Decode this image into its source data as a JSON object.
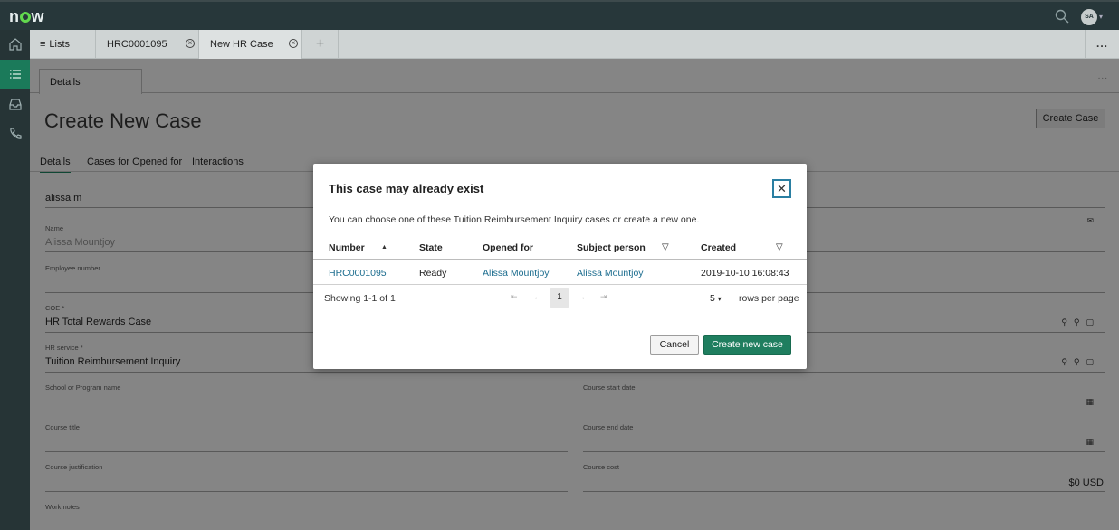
{
  "app": {
    "logo": "now",
    "avatar_initials": "SA"
  },
  "rail": [
    "home-icon",
    "list-icon",
    "inbox-icon",
    "phone-icon"
  ],
  "tabs": {
    "lists": "Lists",
    "case_tab": "HRC0001095",
    "new_tab": "New HR Case",
    "add": "+",
    "more": "..."
  },
  "page": {
    "subtab": "Details",
    "more": "...",
    "title": "Create New Case",
    "create_button": "Create Case",
    "form_tabs": [
      "Details",
      "Cases for Opened for",
      "Interactions"
    ],
    "search_value": "alissa m",
    "fields": {
      "name": {
        "label": "Name",
        "value": "Alissa Mountjoy"
      },
      "employee_number": {
        "label": "Employee number",
        "value": ""
      },
      "coe": {
        "label": "COE",
        "value": "HR Total Rewards Case"
      },
      "hr_service": {
        "label": "HR service",
        "value": "Tuition Reimbursement Inquiry"
      },
      "school": {
        "label": "School or Program name",
        "value": ""
      },
      "course_start": {
        "label": "Course start date",
        "value": ""
      },
      "course_title": {
        "label": "Course title",
        "value": ""
      },
      "course_end": {
        "label": "Course end date",
        "value": ""
      },
      "course_justification": {
        "label": "Course justification",
        "value": ""
      },
      "course_cost": {
        "label": "Course cost",
        "value": "$0 USD"
      },
      "work_notes": {
        "label": "Work notes",
        "value": ""
      }
    },
    "required_mark": "*"
  },
  "modal": {
    "title": "This case may already exist",
    "description": "You can choose one of these Tuition Reimbursement Inquiry cases or create a new one.",
    "columns": {
      "number": "Number",
      "state": "State",
      "opened_for": "Opened for",
      "subject_person": "Subject person",
      "created": "Created"
    },
    "rows": [
      {
        "number": "HRC0001095",
        "state": "Ready",
        "opened_for": "Alissa Mountjoy",
        "subject_person": "Alissa Mountjoy",
        "created": "2019-10-10 16:08:43"
      }
    ],
    "pager": {
      "showing": "Showing 1-1 of 1",
      "page": "1",
      "rows_per_page_value": "5",
      "rows_per_page_label": "rows per page"
    },
    "cancel": "Cancel",
    "create_new": "Create new case"
  },
  "colors": {
    "brand": "#1f7e5f",
    "link": "#1b6c8e",
    "topbar": "#27373a"
  }
}
